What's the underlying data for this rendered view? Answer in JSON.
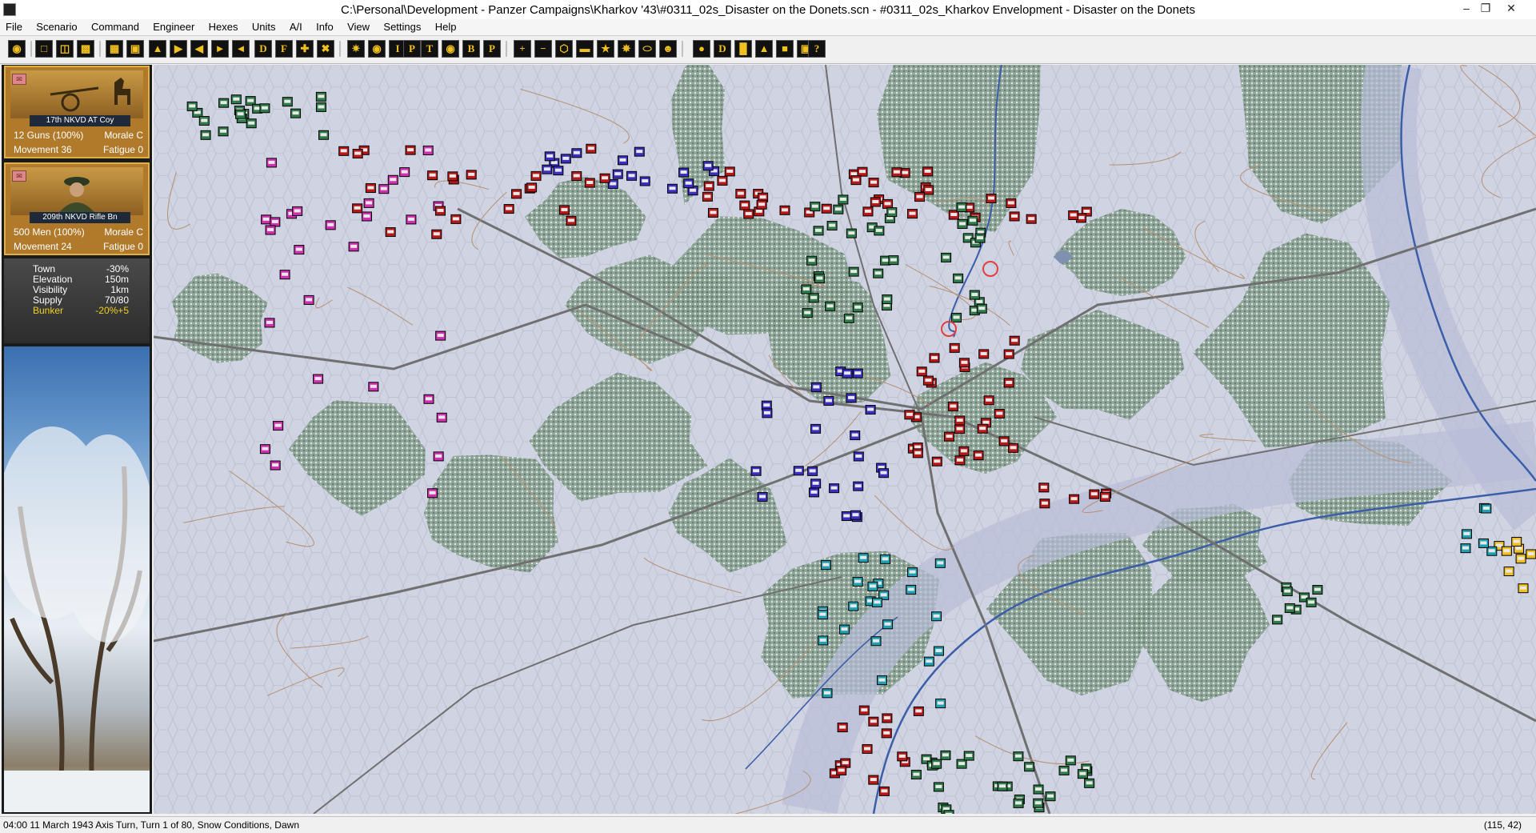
{
  "window": {
    "title": "C:\\Personal\\Development - Panzer Campaigns\\Kharkov '43\\#0311_02s_Disaster on the Donets.scn - #0311_02s_Kharkov Envelopment - Disaster on the Donets"
  },
  "menu": [
    "File",
    "Scenario",
    "Command",
    "Engineer",
    "Hexes",
    "Units",
    "A/I",
    "Info",
    "View",
    "Settings",
    "Help"
  ],
  "toolbar": {
    "letters": {
      "d1": "D",
      "f1": "F",
      "d2": "D",
      "i1": "I",
      "p1": "P",
      "t1": "T",
      "b1": "B",
      "p2": "P",
      "d3": "D",
      "q": "?"
    }
  },
  "units": [
    {
      "name": "17th NKVD AT Coy",
      "strength": "12 Guns (100%)",
      "morale": "Morale C",
      "movement": "Movement 36",
      "fatigue": "Fatigue 0"
    },
    {
      "name": "209th NKVD Rifle Bn",
      "strength": "500 Men (100%)",
      "morale": "Morale C",
      "movement": "Movement 24",
      "fatigue": "Fatigue 0"
    }
  ],
  "terrain": {
    "rows": [
      {
        "label": "Town",
        "value": "-30%"
      },
      {
        "label": "Elevation",
        "value": "150m"
      },
      {
        "label": "Visibility",
        "value": "1km"
      },
      {
        "label": "Supply",
        "value": "70/80"
      },
      {
        "label": "Bunker",
        "value": "-20%+5"
      }
    ]
  },
  "status": {
    "text": "04:00 11 March 1943 Axis Turn, Turn 1 of 80, Snow Conditions, Dawn",
    "coords": "(115, 42)"
  },
  "colors": {
    "map_snow": "#cfd3e2",
    "forest": "#7d9a85",
    "soviet_unit": "#b81818",
    "german_unit": "#2e7a48",
    "axis_blue": "#3a2fc0",
    "magenta": "#d030b0",
    "river": "#3c5ea8"
  }
}
